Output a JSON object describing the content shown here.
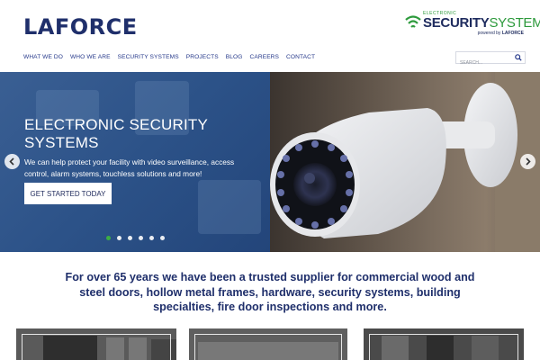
{
  "header": {
    "logo": "LAFORCE",
    "partner_logo": {
      "top": "ELECTRONIC",
      "security": "SECURITY",
      "systems": "SYSTEMS",
      "powered_prefix": "powered by",
      "powered_brand": "LAFORCE"
    },
    "nav": [
      "WHAT WE DO",
      "WHO WE ARE",
      "SECURITY SYSTEMS",
      "PROJECTS",
      "BLOG",
      "CAREERS",
      "CONTACT"
    ],
    "search": {
      "placeholder": "SEARCH..."
    }
  },
  "hero": {
    "title": "ELECTRONIC SECURITY SYSTEMS",
    "description": "We can help protect your facility with video surveillance, access control, alarm systems, touchless solutions and more!",
    "cta": "GET STARTED TODAY",
    "slides": 6,
    "active_slide": 1
  },
  "tagline": "For over 65 years we have been a trusted supplier for commercial wood and steel doors, hollow metal frames, hardware, security systems, building specialties, fire door inspections and more.",
  "colors": {
    "brand_navy": "#1f2f6b",
    "accent_green": "#3cae44",
    "hero_blue": "#2c5288"
  }
}
